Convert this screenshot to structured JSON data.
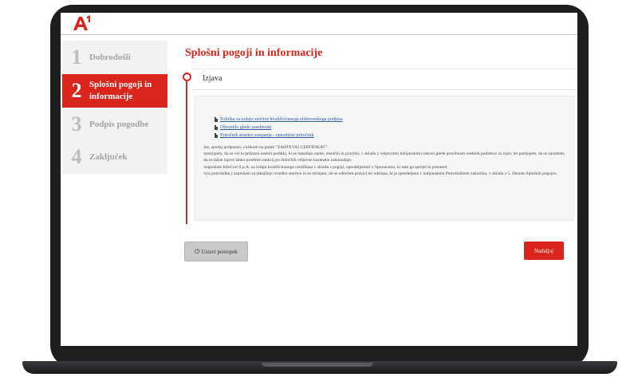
{
  "brand": {
    "logo_text": "A",
    "logo_superscript": "1",
    "accent": "#d9251c"
  },
  "steps": [
    {
      "num": "1",
      "label": "Dobrodošli"
    },
    {
      "num": "2",
      "label": "Splošni pogoji in informacije"
    },
    {
      "num": "3",
      "label": "Podpis pogodbe"
    },
    {
      "num": "4",
      "label": "Zaključek"
    }
  ],
  "page_title": "Splošni pogoji in informacije",
  "section": {
    "title": "Izjava"
  },
  "links": [
    "Politika za izdajo storitve kvalificiranega elektronskega podpisa",
    "Obvestilo glede zasebnosti",
    "Priročnik storitev zaupanja - operativni priročnik"
  ],
  "declaration": {
    "intro": "Jaz, spodaj podpisani, s klikom na gumb \"ZAHTEVAJ CERTIFIKAT\":",
    "p1": "•potrjujem, da so vsi tu prikazni osebni podatki, ki se nanašajo name, resnični in pravilni, v skladu z veljavnimi italijanskimi zakoni glede pravilnosti osebnih podatkov in izjav, ter potrjujem, da se zavedam, da so lažne izjave lahko predmet sankcij po določilih veljavne kazenske zakonodaje;",
    "p2": "•zaprošam InfoCert S.p.A. za izdajo kvalificiranega certifikata v skladu s pogoji, opredeljenimi v Sporazumu, ki sem ga sprejel in prenesel;",
    "p3": "•(za potrošnike,) zaprošam za takojšnjo izvedbo storitve in se strinjam, da se odrečem pravici do odstopa, ki je opredeljena v italijanskem Potrošniškem zakoniku, v skladu s 5. členom Splošnih pogojev."
  },
  "buttons": {
    "stop": "Ustavi postopek",
    "next": "Nadaljuj"
  }
}
